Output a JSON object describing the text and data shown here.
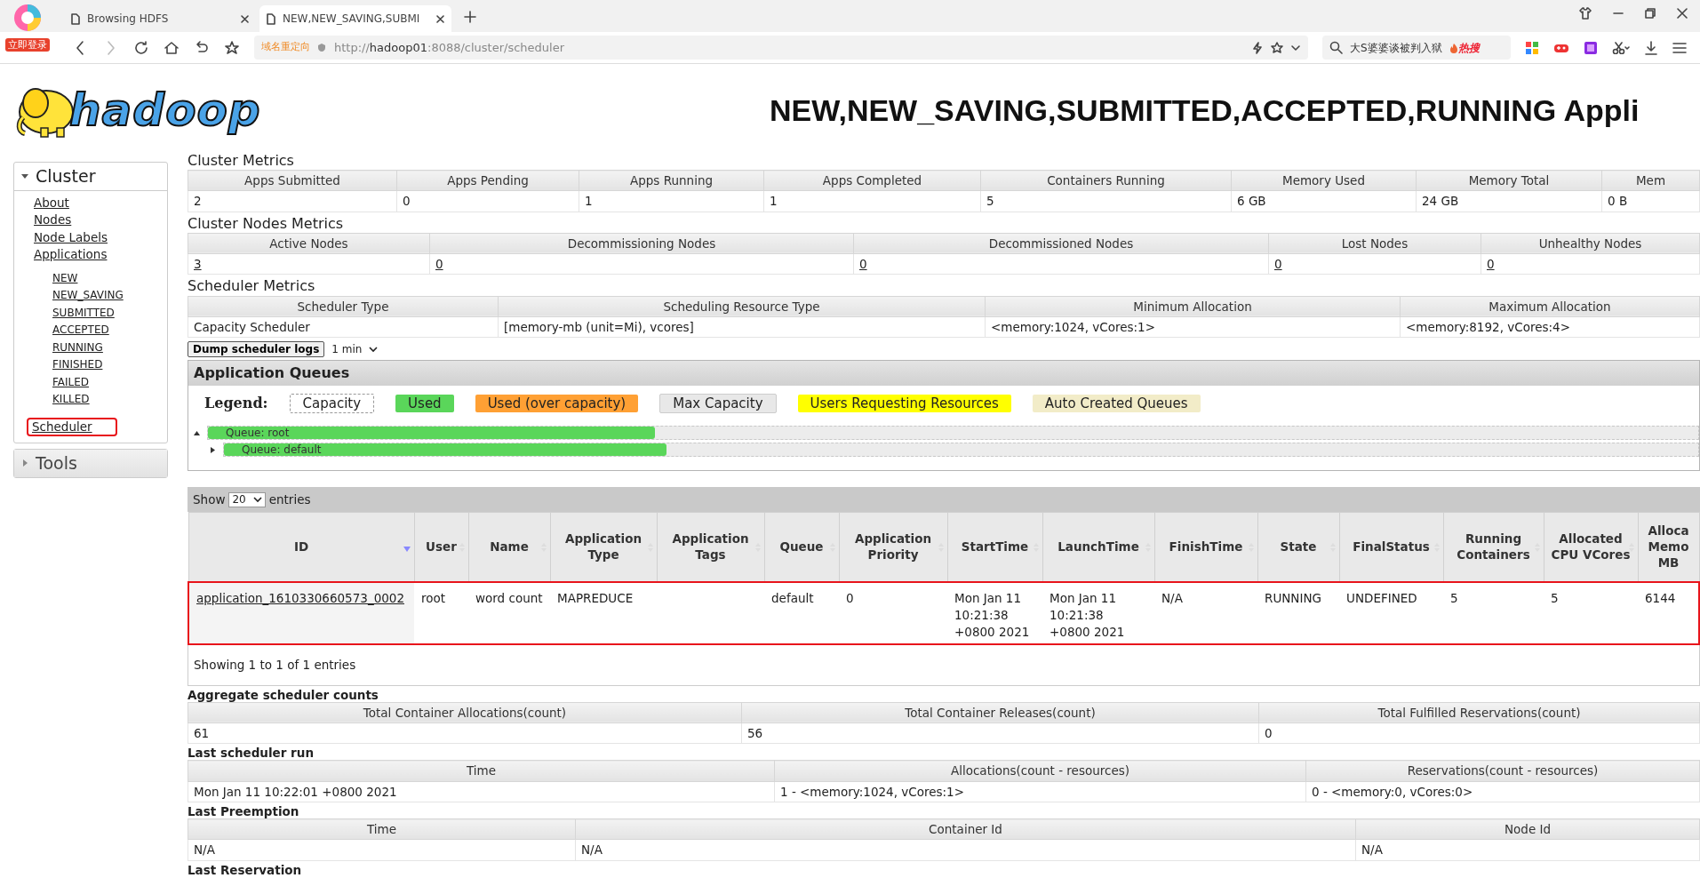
{
  "browser": {
    "login_label": "立即登录",
    "tabs": [
      {
        "title": "Browsing HDFS",
        "selected": false
      },
      {
        "title": "NEW,NEW_SAVING,SUBMI",
        "selected": true
      }
    ],
    "redirect_label": "域名重定向",
    "url_scheme": "http://",
    "url_host": "hadoop01",
    "url_rest": ":8088/cluster/scheduler",
    "search_text": "大S婆婆谈被判入狱",
    "hot_label": "热搜"
  },
  "header": {
    "logo_text": "hadoop",
    "title": "NEW,NEW_SAVING,SUBMITTED,ACCEPTED,RUNNING Appli"
  },
  "sidebar": [
    {
      "label": "Cluster",
      "expanded": true,
      "items": [
        {
          "label": "About",
          "highlighted": false
        },
        {
          "label": "Nodes",
          "highlighted": false
        },
        {
          "label": "Node Labels",
          "highlighted": false
        },
        {
          "label": "Applications",
          "highlighted": false,
          "children": [
            {
              "label": "NEW"
            },
            {
              "label": "NEW_SAVING"
            },
            {
              "label": "SUBMITTED"
            },
            {
              "label": "ACCEPTED"
            },
            {
              "label": "RUNNING"
            },
            {
              "label": "FINISHED"
            },
            {
              "label": "FAILED"
            },
            {
              "label": "KILLED"
            }
          ]
        },
        {
          "label": "Scheduler",
          "highlighted": true
        }
      ]
    },
    {
      "label": "Tools",
      "expanded": false
    }
  ],
  "cluster_metrics": {
    "title": "Cluster Metrics",
    "columns": [
      "Apps Submitted",
      "Apps Pending",
      "Apps Running",
      "Apps Completed",
      "Containers Running",
      "Memory Used",
      "Memory Total",
      "Mem"
    ],
    "rows": [
      [
        "2",
        "0",
        "1",
        "1",
        "5",
        "6 GB",
        "24 GB",
        "0 B"
      ]
    ]
  },
  "node_metrics": {
    "title": "Cluster Nodes Metrics",
    "linked": true,
    "columns": [
      "Active Nodes",
      "Decommissioning Nodes",
      "Decommissioned Nodes",
      "Lost Nodes",
      "Unhealthy Nodes"
    ],
    "rows": [
      [
        "3",
        "0",
        "0",
        "0",
        "0"
      ]
    ]
  },
  "scheduler_metrics": {
    "title": "Scheduler Metrics",
    "columns": [
      "Scheduler Type",
      "Scheduling Resource Type",
      "Minimum Allocation",
      "Maximum Allocation"
    ],
    "rows": [
      [
        "Capacity Scheduler",
        "[memory-mb (unit=Mi), vcores]",
        "<memory:1024, vCores:1>",
        "<memory:8192, vCores:4>"
      ]
    ]
  },
  "dump": {
    "label": "Dump scheduler logs",
    "interval": "1 min"
  },
  "queues": {
    "title": "Application Queues",
    "legend_label": "Legend:",
    "legend": [
      {
        "label": "Capacity",
        "kind": "capacity"
      },
      {
        "label": "Used",
        "kind": "used"
      },
      {
        "label": "Used (over capacity)",
        "kind": "over"
      },
      {
        "label": "Max Capacity",
        "kind": "max"
      },
      {
        "label": "Users Requesting Resources",
        "kind": "users"
      },
      {
        "label": "Auto Created Queues",
        "kind": "auto"
      }
    ],
    "tree": [
      {
        "label": "Queue: root",
        "expanded": true,
        "level": 0.3,
        "children": [
          {
            "label": "Queue: default",
            "expanded": false,
            "level": 0.3
          }
        ]
      }
    ]
  },
  "apps": {
    "show_label": "Show",
    "page_size": "20",
    "entries_label": "entries",
    "columns": [
      {
        "label": "ID",
        "sorted": true
      },
      {
        "label": "User",
        "sorted": false
      },
      {
        "label": "Name",
        "sorted": false
      },
      {
        "label": "Application Type",
        "sorted": false
      },
      {
        "label": "Application Tags",
        "sorted": false
      },
      {
        "label": "Queue",
        "sorted": false
      },
      {
        "label": "Application Priority",
        "sorted": false
      },
      {
        "label": "StartTime",
        "sorted": false
      },
      {
        "label": "LaunchTime",
        "sorted": false
      },
      {
        "label": "FinishTime",
        "sorted": false
      },
      {
        "label": "State",
        "sorted": false
      },
      {
        "label": "FinalStatus",
        "sorted": false
      },
      {
        "label": "Running Containers",
        "sorted": false
      },
      {
        "label": "Allocated CPU VCores",
        "sorted": false
      },
      {
        "label": "Alloca Memo MB",
        "sorted": false
      }
    ],
    "rows": [
      {
        "highlighted": true,
        "cells": [
          "application_1610330660573_0002",
          "root",
          "word count",
          "MAPREDUCE",
          "",
          "default",
          "0",
          "Mon Jan 11 10:21:38 +0800 2021",
          "Mon Jan 11 10:21:38 +0800 2021",
          "N/A",
          "RUNNING",
          "UNDEFINED",
          "5",
          "5",
          "6144"
        ]
      }
    ],
    "info": "Showing 1 to 1 of 1 entries"
  },
  "aggregate": {
    "title": "Aggregate scheduler counts",
    "columns": [
      "Total Container Allocations(count)",
      "Total Container Releases(count)",
      "Total Fulfilled Reservations(count)"
    ],
    "rows": [
      [
        "61",
        "56",
        "0"
      ]
    ]
  },
  "last_run": {
    "title": "Last scheduler run",
    "columns": [
      "Time",
      "Allocations(count - resources)",
      "Reservations(count - resources)"
    ],
    "rows": [
      [
        "Mon Jan 11 10:22:01 +0800 2021",
        "1 - <memory:1024, vCores:1>",
        "0 - <memory:0, vCores:0>"
      ]
    ]
  },
  "last_preemption": {
    "title": "Last Preemption",
    "columns": [
      "Time",
      "Container Id",
      "Node Id"
    ],
    "rows": [
      [
        "N/A",
        "N/A",
        "N/A"
      ]
    ]
  },
  "last_reservation": {
    "title": "Last Reservation"
  }
}
